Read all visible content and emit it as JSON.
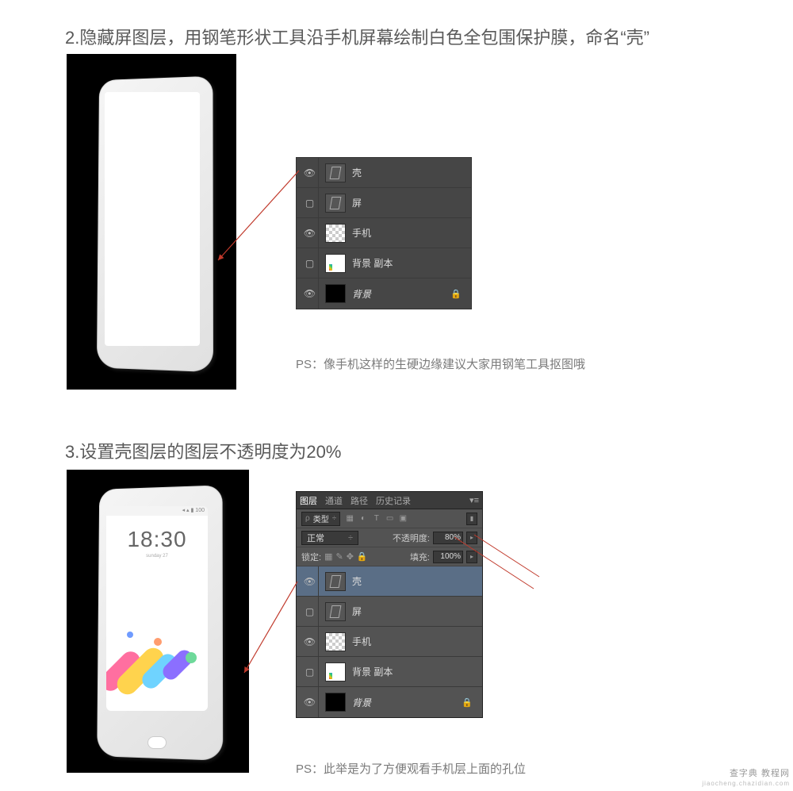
{
  "step2": {
    "heading": "2.隐藏屏图层，用钢笔形状工具沿手机屏幕绘制白色全包围保护膜，命名“壳”",
    "ps_note": "PS：像手机这样的生硬边缘建议大家用钢笔工具抠图哦",
    "layers": [
      {
        "name": "壳",
        "visible": true,
        "thumb": "shape",
        "italic": false
      },
      {
        "name": "屏",
        "visible": false,
        "thumb": "shape",
        "italic": false
      },
      {
        "name": "手机",
        "visible": true,
        "thumb": "checker",
        "italic": false
      },
      {
        "name": "背景 副本",
        "visible": false,
        "thumb": "white",
        "italic": false
      },
      {
        "name": "背景",
        "visible": true,
        "thumb": "black",
        "italic": true,
        "locked": true
      }
    ]
  },
  "step3": {
    "heading": "3.设置壳图层的图层不透明度为20%",
    "ps_note": "PS：此举是为了方便观看手机层上面的孔位",
    "phone": {
      "status": "◂ ▴ ▮ 100",
      "clock": "18:30",
      "clock_sub": "sunday  27"
    },
    "panel": {
      "tabs": {
        "layers": "图层",
        "channels": "通道",
        "paths": "路径",
        "history": "历史记录"
      },
      "kind_label": "类型",
      "blend_mode": "正常",
      "opacity_label": "不透明度:",
      "opacity_value": "80%",
      "lock_label": "锁定:",
      "fill_label": "填充:",
      "fill_value": "100%"
    },
    "layers": [
      {
        "name": "壳",
        "visible": true,
        "thumb": "shape",
        "selected": true
      },
      {
        "name": "屏",
        "visible": false,
        "thumb": "shape"
      },
      {
        "name": "手机",
        "visible": true,
        "thumb": "checker"
      },
      {
        "name": "背景 副本",
        "visible": false,
        "thumb": "white"
      },
      {
        "name": "背景",
        "visible": true,
        "thumb": "black",
        "italic": true,
        "locked": true
      }
    ]
  },
  "watermark": {
    "line1": "查字典 教程网",
    "line2": "jiaocheng.chazidian.com"
  }
}
